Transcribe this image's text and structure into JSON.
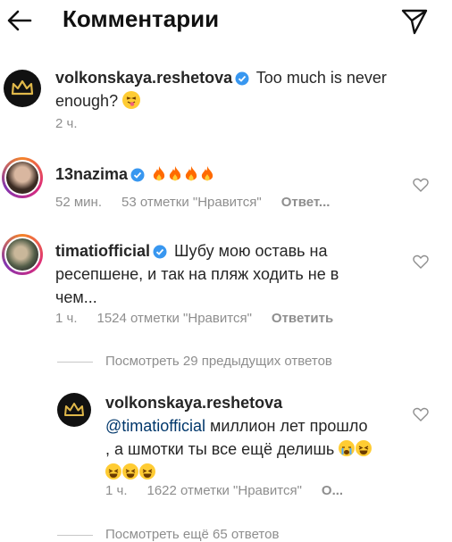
{
  "header": {
    "title": "Комментарии"
  },
  "caption": {
    "username": "volkonskaya.reshetova",
    "text": "Too much is never enough?",
    "emoji": "😝",
    "time": "2 ч."
  },
  "comments": [
    {
      "username": "13nazima",
      "text_emoji": "🔥🔥🔥🔥",
      "time": "52 мин.",
      "likes": "53 отметки \"Нравится\"",
      "reply": "Ответ..."
    },
    {
      "username": "timatiofficial",
      "text": "Шубу мою оставь на ресепшене, и так на пляж ходить не в чем...",
      "time": "1 ч.",
      "likes": "1524 отметки \"Нравится\"",
      "reply": "Ответить",
      "view_replies": "Посмотреть 29 предыдущих ответов"
    }
  ],
  "reply": {
    "username": "volkonskaya.reshetova",
    "mention": "@timatiofficial",
    "text": "миллион лет прошло , а шмотки ты все ещё делишь",
    "emojis": "😭😆😆😆😆",
    "time": "1 ч.",
    "likes": "1622 отметки \"Нравится\"",
    "reply": "О...",
    "view_more": "Посмотреть ещё 65 ответов"
  },
  "colors": {
    "verified": "#3897f0",
    "meta": "#8e8e8e",
    "fire": "#ff6a00",
    "emoji": "#ffcc33"
  }
}
